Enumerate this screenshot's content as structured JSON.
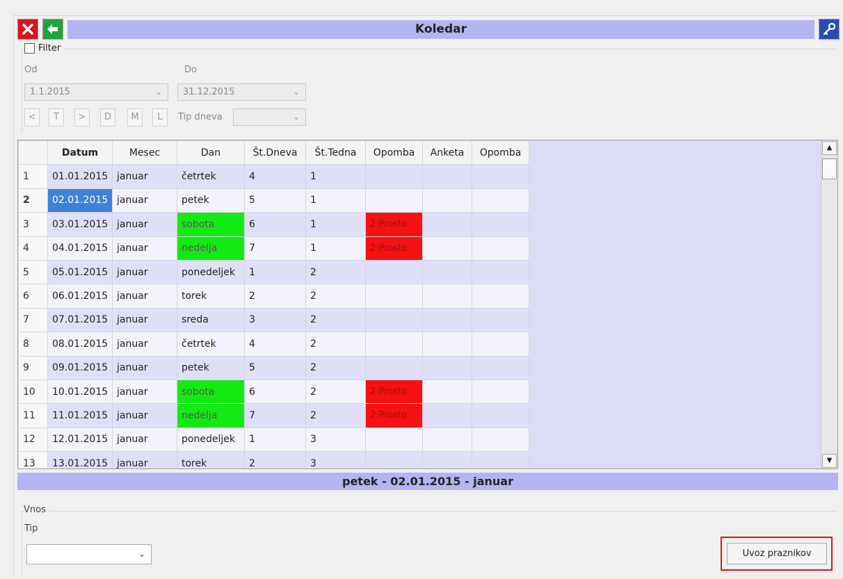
{
  "window": {
    "title": "Koledar"
  },
  "filter": {
    "checkbox_label": "Filter",
    "od_label": "Od",
    "do_label": "Do",
    "od_value": "1.1.2015",
    "do_value": "31.12.2015",
    "nav_buttons": [
      "<",
      "T",
      ">",
      "D",
      "M",
      "L"
    ],
    "tip_dneva_label": "Tip dneva",
    "tip_dneva_value": ""
  },
  "grid": {
    "columns": [
      "Datum",
      "Mesec",
      "Dan",
      "Št.Dneva",
      "Št.Tedna",
      "Opomba",
      "Anketa",
      "Opomba"
    ],
    "rows": [
      {
        "n": "1",
        "datum": "01.01.2015",
        "mesec": "januar",
        "dan": "četrtek",
        "st_dneva": "4",
        "st_tedna": "1",
        "opomba": "",
        "anketa": "",
        "opomba2": ""
      },
      {
        "n": "2",
        "datum": "02.01.2015",
        "mesec": "januar",
        "dan": "petek",
        "st_dneva": "5",
        "st_tedna": "1",
        "opomba": "",
        "anketa": "",
        "opomba2": ""
      },
      {
        "n": "3",
        "datum": "03.01.2015",
        "mesec": "januar",
        "dan": "sobota",
        "st_dneva": "6",
        "st_tedna": "1",
        "opomba": "2:Prosto",
        "anketa": "",
        "opomba2": ""
      },
      {
        "n": "4",
        "datum": "04.01.2015",
        "mesec": "januar",
        "dan": "nedelja",
        "st_dneva": "7",
        "st_tedna": "1",
        "opomba": "2:Prosto",
        "anketa": "",
        "opomba2": ""
      },
      {
        "n": "5",
        "datum": "05.01.2015",
        "mesec": "januar",
        "dan": "ponedeljek",
        "st_dneva": "1",
        "st_tedna": "2",
        "opomba": "",
        "anketa": "",
        "opomba2": ""
      },
      {
        "n": "6",
        "datum": "06.01.2015",
        "mesec": "januar",
        "dan": "torek",
        "st_dneva": "2",
        "st_tedna": "2",
        "opomba": "",
        "anketa": "",
        "opomba2": ""
      },
      {
        "n": "7",
        "datum": "07.01.2015",
        "mesec": "januar",
        "dan": "sreda",
        "st_dneva": "3",
        "st_tedna": "2",
        "opomba": "",
        "anketa": "",
        "opomba2": ""
      },
      {
        "n": "8",
        "datum": "08.01.2015",
        "mesec": "januar",
        "dan": "četrtek",
        "st_dneva": "4",
        "st_tedna": "2",
        "opomba": "",
        "anketa": "",
        "opomba2": ""
      },
      {
        "n": "9",
        "datum": "09.01.2015",
        "mesec": "januar",
        "dan": "petek",
        "st_dneva": "5",
        "st_tedna": "2",
        "opomba": "",
        "anketa": "",
        "opomba2": ""
      },
      {
        "n": "10",
        "datum": "10.01.2015",
        "mesec": "januar",
        "dan": "sobota",
        "st_dneva": "6",
        "st_tedna": "2",
        "opomba": "2:Prosto",
        "anketa": "",
        "opomba2": ""
      },
      {
        "n": "11",
        "datum": "11.01.2015",
        "mesec": "januar",
        "dan": "nedelja",
        "st_dneva": "7",
        "st_tedna": "2",
        "opomba": "2:Prosto",
        "anketa": "",
        "opomba2": ""
      },
      {
        "n": "12",
        "datum": "12.01.2015",
        "mesec": "januar",
        "dan": "ponedeljek",
        "st_dneva": "1",
        "st_tedna": "3",
        "opomba": "",
        "anketa": "",
        "opomba2": ""
      },
      {
        "n": "13",
        "datum": "13.01.2015",
        "mesec": "januar",
        "dan": "torek",
        "st_dneva": "2",
        "st_tedna": "3",
        "opomba": "",
        "anketa": "",
        "opomba2": ""
      }
    ]
  },
  "status": {
    "text": "petek - 02.01.2015 - januar"
  },
  "vnos": {
    "group_label": "Vnos",
    "tip_label": "Tip",
    "tip_value": "",
    "import_button": "Uvoz praznikov"
  },
  "colors": {
    "header_strip": "#b4b4f2",
    "weekend": "#13ea13",
    "holiday": "#f41212",
    "selection": "#3c82d8",
    "highlight_frame": "#d01818"
  },
  "icons": {
    "close": "close-icon",
    "back": "back-arrow-icon",
    "edit": "edit-key-icon"
  }
}
